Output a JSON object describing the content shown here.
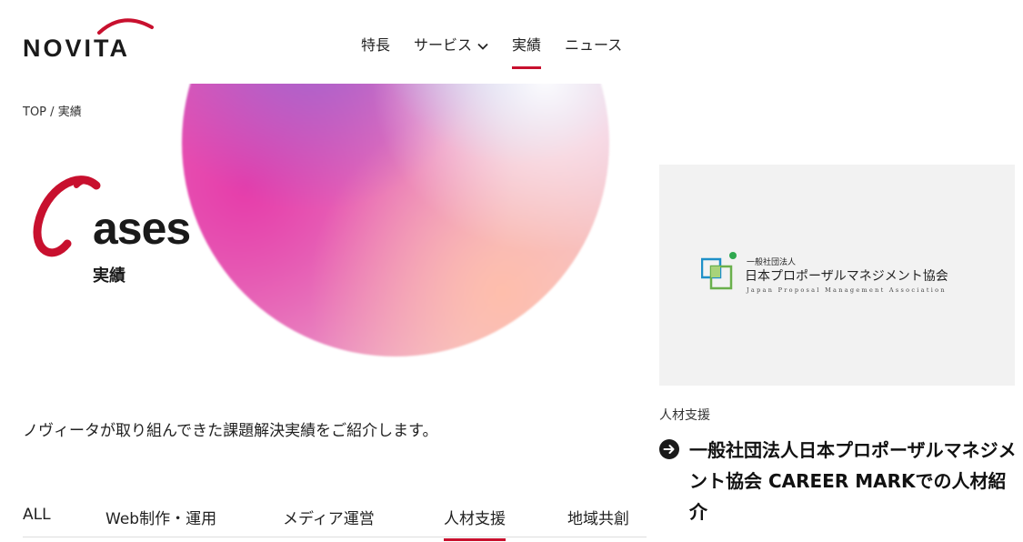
{
  "brand": {
    "logo_text": "NOVITA",
    "accent": "#c8102e"
  },
  "nav": {
    "items": [
      {
        "label": "特長"
      },
      {
        "label": "サービス",
        "has_dropdown": true
      },
      {
        "label": "実績",
        "active": true
      },
      {
        "label": "ニュース"
      }
    ]
  },
  "breadcrumb": {
    "home": "TOP",
    "separator": "/",
    "current": "実績"
  },
  "hero": {
    "title_initial": "C",
    "title_rest": "ases",
    "subtitle": "実績"
  },
  "intro": "ノヴィータが取り組んできた課題解決実績をご紹介します。",
  "filter_tabs": [
    {
      "label": "ALL"
    },
    {
      "label": "Web制作・運用"
    },
    {
      "label": "メディア運営"
    },
    {
      "label": "人材支援",
      "active": true
    },
    {
      "label": "地域共創"
    }
  ],
  "card": {
    "thumbnail": {
      "org_type": "一般社団法人",
      "org_name": "日本プロポーザルマネジメント協会",
      "org_name_en": "Japan Proposal Management Association"
    },
    "category": "人材支援",
    "title": "一般社団法人日本プロポーザルマネジメント協会 CAREER MARKでの人材紹介",
    "arrow_icon": "arrow-right-circle-icon"
  }
}
